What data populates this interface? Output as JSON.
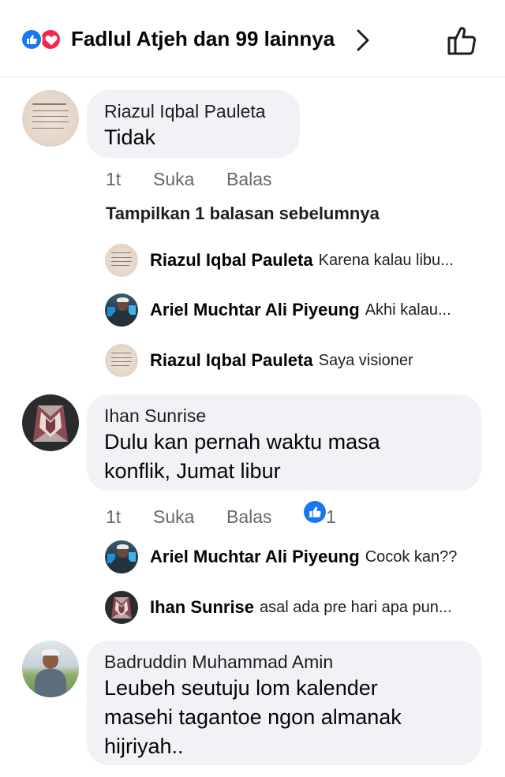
{
  "header": {
    "likers_text": "Fadlul Atjeh dan 99 lainnya",
    "icons": [
      "like-reaction-icon",
      "love-reaction-icon",
      "chevron-right-icon",
      "thumbs-up-outline-icon"
    ]
  },
  "comments": [
    {
      "author": "Riazul Iqbal Pauleta",
      "text": "Tidak",
      "time": "1t",
      "like_label": "Suka",
      "reply_label": "Balas"
    },
    {
      "author": "Ihan Sunrise",
      "text_line1": "Dulu kan pernah waktu masa",
      "text_line2": "konflik, Jumat libur",
      "time": "1t",
      "like_label": "Suka",
      "reply_label": "Balas",
      "reaction_count": "1"
    },
    {
      "author": "Badruddin Muhammad Amin",
      "text_line1": "Leubeh seutuju lom kalender",
      "text_line2": "masehi tagantoe ngon almanak",
      "text_line3": "hijriyah.."
    }
  ],
  "previous_replies_label": "Tampilkan 1 balasan sebelumnya",
  "replies_group1": [
    {
      "author": "Riazul Iqbal Pauleta",
      "text": "Karena kalau libu..."
    },
    {
      "author": "Ariel Muchtar Ali Piyeung",
      "text": "Akhi kalau..."
    },
    {
      "author": "Riazul Iqbal Pauleta",
      "text": "Saya visioner"
    }
  ],
  "replies_group2": [
    {
      "author": "Ariel Muchtar Ali Piyeung",
      "text": "Cocok kan??"
    },
    {
      "author": "Ihan Sunrise",
      "text": "asal ada pre hari apa pun..."
    }
  ],
  "colors": {
    "like_blue": "#1877f2",
    "love_red": "#f0284a",
    "bubble_gray": "#f0f2f5",
    "meta_gray": "#65676b"
  }
}
